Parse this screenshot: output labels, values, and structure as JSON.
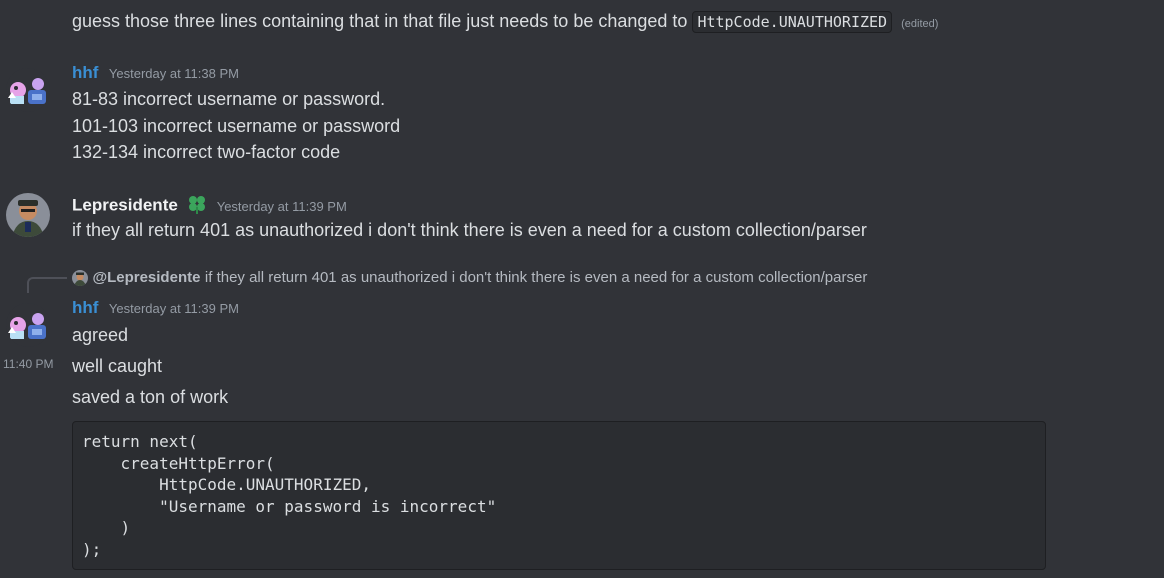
{
  "messages": {
    "top_fragment": {
      "text": "guess those three lines containing that in that file just needs to be changed to",
      "code": "HttpCode.UNAUTHORIZED",
      "edited": "(edited)"
    },
    "hhf_1": {
      "author": "hhf",
      "author_color": "#3a8fd4",
      "timestamp": "Yesterday at 11:38 PM",
      "lines": [
        "81-83 incorrect username or password.",
        "101-103 incorrect username or password",
        "132-134 incorrect two-factor code"
      ]
    },
    "lepresidente": {
      "author": "Lepresidente",
      "author_color": "#f2f3f5",
      "badge_icon": "clover-icon",
      "badge_color": "#3ba55c",
      "timestamp": "Yesterday at 11:39 PM",
      "text": "if they all return 401 as unauthorized i don't think there is even a need for a custom collection/parser"
    },
    "reply": {
      "mention": "@Lepresidente",
      "text": "if they all return 401 as unauthorized i don't think there is even a need for a custom collection/parser"
    },
    "hhf_2": {
      "author": "hhf",
      "author_color": "#3a8fd4",
      "timestamp": "Yesterday at 11:39 PM",
      "lines": [
        "agreed"
      ],
      "side_timestamp": "11:40 PM",
      "followups": [
        "well caught",
        "saved a ton of work"
      ],
      "code_block": "return next(\n    createHttpError(\n        HttpCode.UNAUTHORIZED,\n        \"Username or password is incorrect\"\n    )\n);"
    }
  }
}
